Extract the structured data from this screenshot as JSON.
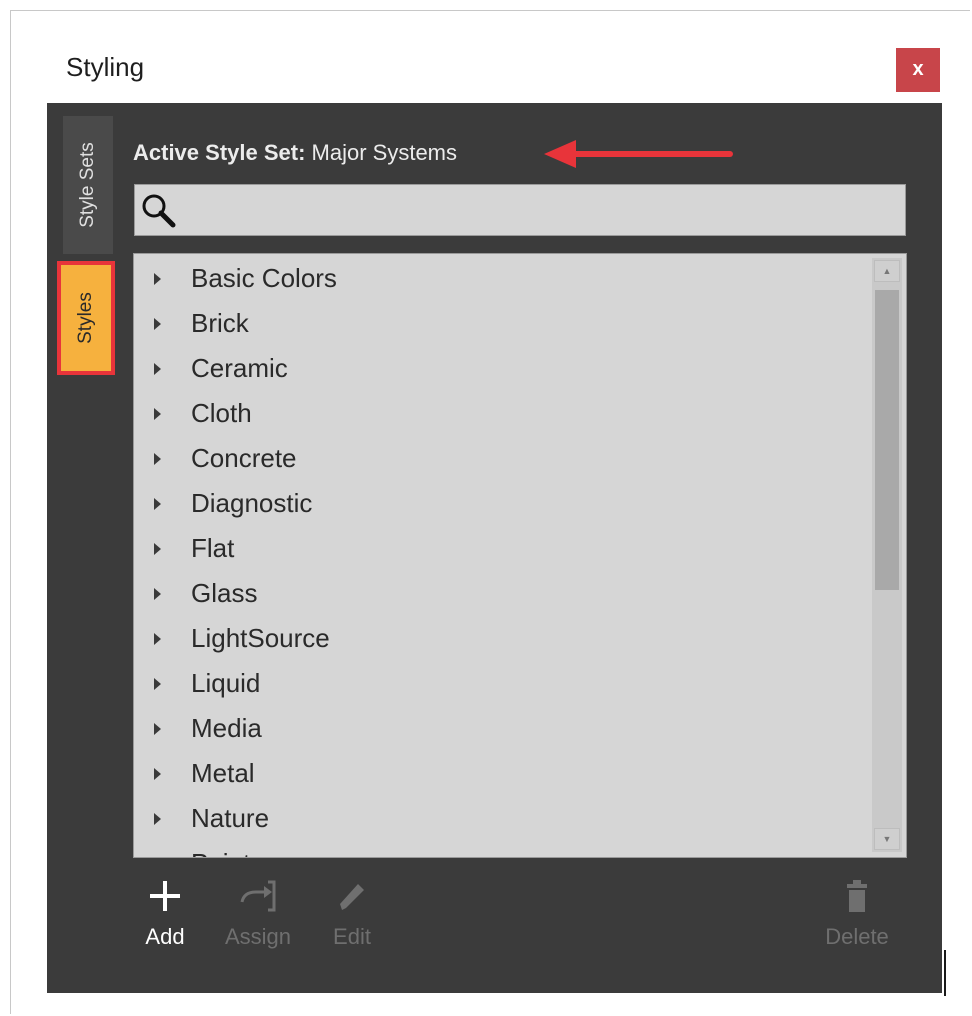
{
  "window": {
    "title": "Styling",
    "close_label": "x"
  },
  "tabs": [
    {
      "label": "Style Sets",
      "active": false
    },
    {
      "label": "Styles",
      "active": true
    }
  ],
  "active_style_set": {
    "label": "Active Style Set:",
    "value": "Major Systems"
  },
  "search": {
    "placeholder": "",
    "value": "",
    "icon": "search-icon"
  },
  "tree": {
    "items": [
      {
        "label": "Basic Colors"
      },
      {
        "label": "Brick"
      },
      {
        "label": "Ceramic"
      },
      {
        "label": "Cloth"
      },
      {
        "label": "Concrete"
      },
      {
        "label": "Diagnostic"
      },
      {
        "label": "Flat"
      },
      {
        "label": "Glass"
      },
      {
        "label": "LightSource"
      },
      {
        "label": "Liquid"
      },
      {
        "label": "Media"
      },
      {
        "label": "Metal"
      },
      {
        "label": "Nature"
      },
      {
        "label": "Paint"
      }
    ]
  },
  "toolbar": {
    "add_label": "Add",
    "assign_label": "Assign",
    "edit_label": "Edit",
    "delete_label": "Delete"
  },
  "colors": {
    "panel_bg": "#3b3b3b",
    "active_tab": "#f6b13e",
    "highlight_border": "#e8343a",
    "close_button": "#c8454a"
  }
}
